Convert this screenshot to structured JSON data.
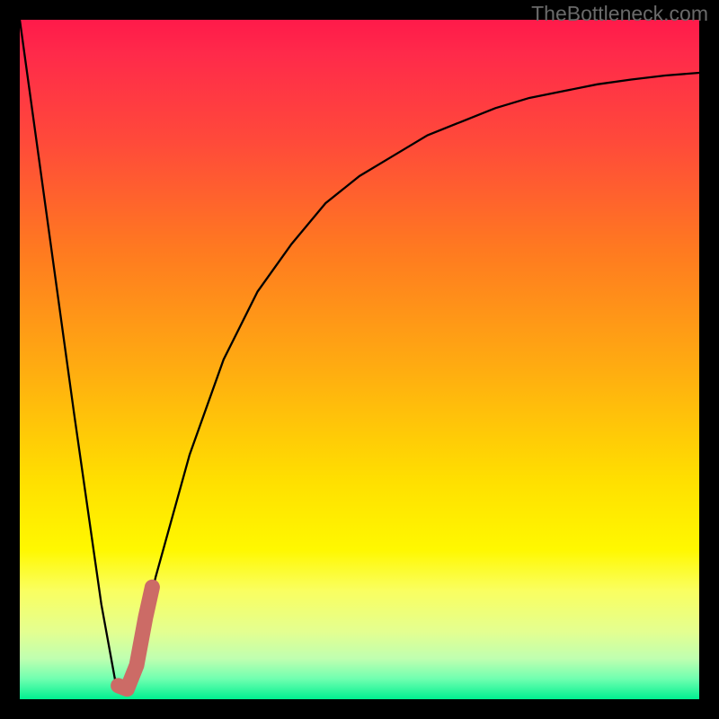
{
  "watermark": "TheBottleneck.com",
  "colors": {
    "background": "#000000",
    "gradient_top": "#ff1a4a",
    "gradient_mid": "#ffe000",
    "gradient_bottom": "#00f090",
    "curve": "#000000",
    "marker": "#cc6b66",
    "watermark_text": "#6a6a6a"
  },
  "chart_data": {
    "type": "line",
    "title": "",
    "xlabel": "",
    "ylabel": "",
    "xlim": [
      0,
      100
    ],
    "ylim": [
      0,
      100
    ],
    "series": [
      {
        "name": "bottleneck-curve",
        "x": [
          0,
          4,
          8,
          12,
          14,
          16,
          18,
          20,
          25,
          30,
          35,
          40,
          45,
          50,
          55,
          60,
          65,
          70,
          75,
          80,
          85,
          90,
          95,
          100
        ],
        "values": [
          100,
          71,
          42,
          14,
          3,
          2,
          9,
          18,
          36,
          50,
          60,
          67,
          73,
          77,
          80,
          83,
          85,
          87,
          88.5,
          89.5,
          90.5,
          91.2,
          91.8,
          92.2
        ]
      }
    ],
    "marker": {
      "name": "highlight-segment",
      "points": [
        {
          "x": 14.5,
          "y": 2
        },
        {
          "x": 15.8,
          "y": 1.5
        },
        {
          "x": 17.2,
          "y": 5
        },
        {
          "x": 18.5,
          "y": 12
        },
        {
          "x": 19.5,
          "y": 16.5
        }
      ]
    }
  }
}
